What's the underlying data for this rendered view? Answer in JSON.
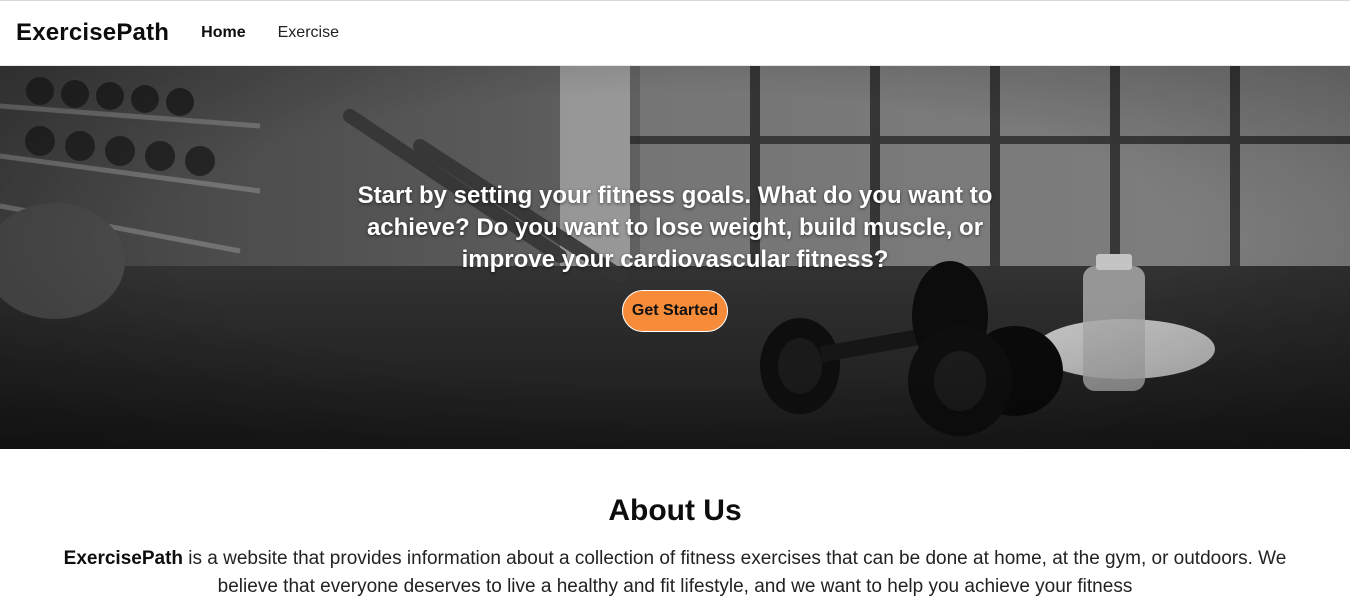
{
  "nav": {
    "brand": "ExercisePath",
    "links": [
      {
        "label": "Home",
        "active": true
      },
      {
        "label": "Exercise",
        "active": false
      }
    ]
  },
  "hero": {
    "headline": "Start by setting your fitness goals. What do you want to achieve? Do you want to lose weight, build muscle, or improve your cardiovascular fitness?",
    "cta_label": "Get Started",
    "cta_color": "#f68b3a",
    "background_image": "gym-dumbbells-photo"
  },
  "about": {
    "title": "About Us",
    "brand_name": "ExercisePath",
    "description": " is a website that provides information about a collection of fitness exercises that can be done at home, at the gym, or outdoors. We believe that everyone deserves to live a healthy and fit lifestyle, and we want to help you achieve your fitness"
  }
}
